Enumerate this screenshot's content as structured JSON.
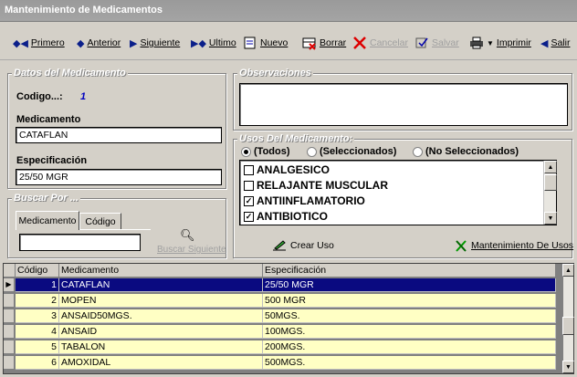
{
  "window": {
    "title": "Mantenimiento de Medicamentos"
  },
  "toolbar": {
    "primero": "Primero",
    "anterior": "Anterior",
    "siguiente": "Siguiente",
    "ultimo": "Ultimo",
    "nuevo": "Nuevo",
    "borrar": "Borrar",
    "cancelar": "Cancelar",
    "salvar": "Salvar",
    "imprimir": "Imprimir",
    "salir": "Salir"
  },
  "datos": {
    "group_title": "Datos del Medicamento",
    "codigo_label": "Codigo...:",
    "codigo_value": "1",
    "medicamento_label": "Medicamento",
    "medicamento_value": "CATAFLAN",
    "especificacion_label": "Especificación",
    "especificacion_value": "25/50 MGR"
  },
  "buscar": {
    "group_title": "Buscar Por ...",
    "tabs": [
      "Medicamento",
      "Código"
    ],
    "input_value": "",
    "next_label": "Buscar Siguiente"
  },
  "observaciones": {
    "group_title": "Observaciones",
    "value": ""
  },
  "usos": {
    "group_title": "Usos Del Medicamento:",
    "filters": [
      "(Todos)",
      "(Seleccionados)",
      "(No Seleccionados)"
    ],
    "selected_filter": "(Todos)",
    "items": [
      {
        "label": "ANALGESICO",
        "checked": false
      },
      {
        "label": "RELAJANTE MUSCULAR",
        "checked": false
      },
      {
        "label": "ANTIINFLAMATORIO",
        "checked": true
      },
      {
        "label": "ANTIBIOTICO",
        "checked": true
      }
    ],
    "crear_label": "Crear Uso",
    "mantenimiento_label": "Mantenimiento De Usos"
  },
  "grid": {
    "headers": [
      "Código",
      "Medicamento",
      "Especificación"
    ],
    "rows": [
      [
        "1",
        "CATAFLAN",
        "25/50 MGR"
      ],
      [
        "2",
        "MOPEN",
        "500 MGR"
      ],
      [
        "3",
        "ANSAID50MGS.",
        "50MGS."
      ],
      [
        "4",
        "ANSAID",
        "100MGS."
      ],
      [
        "5",
        "TABALON",
        "200MGS."
      ],
      [
        "6",
        "AMOXIDAL",
        "500MGS."
      ]
    ],
    "selected_row": 0
  },
  "colors": {
    "selection": "#0a0a80",
    "row_bg": "#ffffc4",
    "code_value": "#0000c0"
  }
}
